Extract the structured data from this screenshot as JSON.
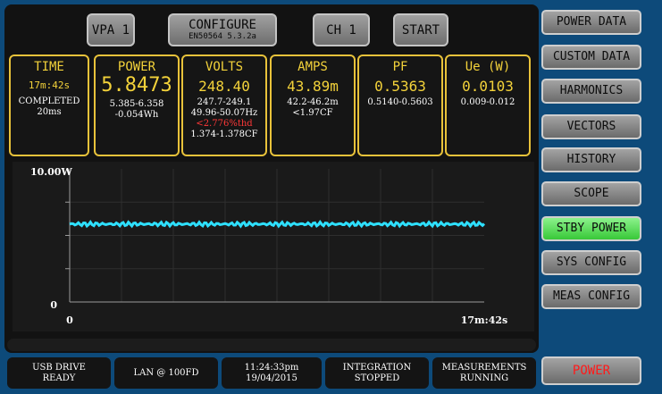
{
  "top_buttons": {
    "vpa": "VPA 1",
    "configure": "CONFIGURE",
    "configure_sub": "EN50564 5.3.2a",
    "channel": "CH 1",
    "start": "START"
  },
  "measurements": {
    "time": {
      "title": "TIME",
      "value": "17m:42s",
      "line1": "COMPLETED",
      "line2": "20ms"
    },
    "power": {
      "title": "POWER",
      "value": "5.8473",
      "line1": "5.385-6.358",
      "line2": "-0.054Wh"
    },
    "volts": {
      "title": "VOLTS",
      "value": "248.40",
      "line1": "247.7-249.1",
      "line2": "49.96-50.07Hz",
      "line3": "<2.776%thd",
      "line4": "1.374-1.378CF"
    },
    "amps": {
      "title": "AMPS",
      "value": "43.89m",
      "line1": "42.2-46.2m",
      "line2": "<1.97CF"
    },
    "pf": {
      "title": "PF",
      "value": "0.5363",
      "line1": "0.5140-0.5603"
    },
    "ue": {
      "title": "Ue (W)",
      "value": "0.0103",
      "line1": "0.009-0.012"
    }
  },
  "chart_data": {
    "type": "line",
    "ymax_label": "10.00W",
    "ymin_label": "0",
    "xmin_label": "0",
    "xmax_label": "17m:42s",
    "ylim": [
      0,
      10
    ],
    "x": [
      "0",
      "17m:42s"
    ],
    "series": [
      {
        "values": [
          5.85,
          5.85
        ],
        "color": "#2ee0ff"
      }
    ],
    "grid": true
  },
  "status": {
    "usb": [
      "USB DRIVE",
      "READY"
    ],
    "lan": [
      "LAN @ 100FD",
      ""
    ],
    "clock": [
      "11:24:33pm",
      "19/04/2015"
    ],
    "integration": [
      "INTEGRATION",
      "STOPPED"
    ],
    "measurements": [
      "MEASUREMENTS",
      "RUNNING"
    ]
  },
  "side_menu": [
    {
      "label": "POWER DATA"
    },
    {
      "label": "CUSTOM DATA"
    },
    {
      "label": "HARMONICS"
    },
    {
      "label": "VECTORS"
    },
    {
      "label": "HISTORY"
    },
    {
      "label": "SCOPE"
    },
    {
      "label": "STBY POWER"
    },
    {
      "label": "SYS CONFIG"
    },
    {
      "label": "MEAS CONFIG"
    }
  ],
  "power_button": "POWER",
  "colors": {
    "accent": "#f3d23a",
    "trace": "#2ee0ff",
    "active": "#5ae05a",
    "alert": "#ff1a1a"
  }
}
